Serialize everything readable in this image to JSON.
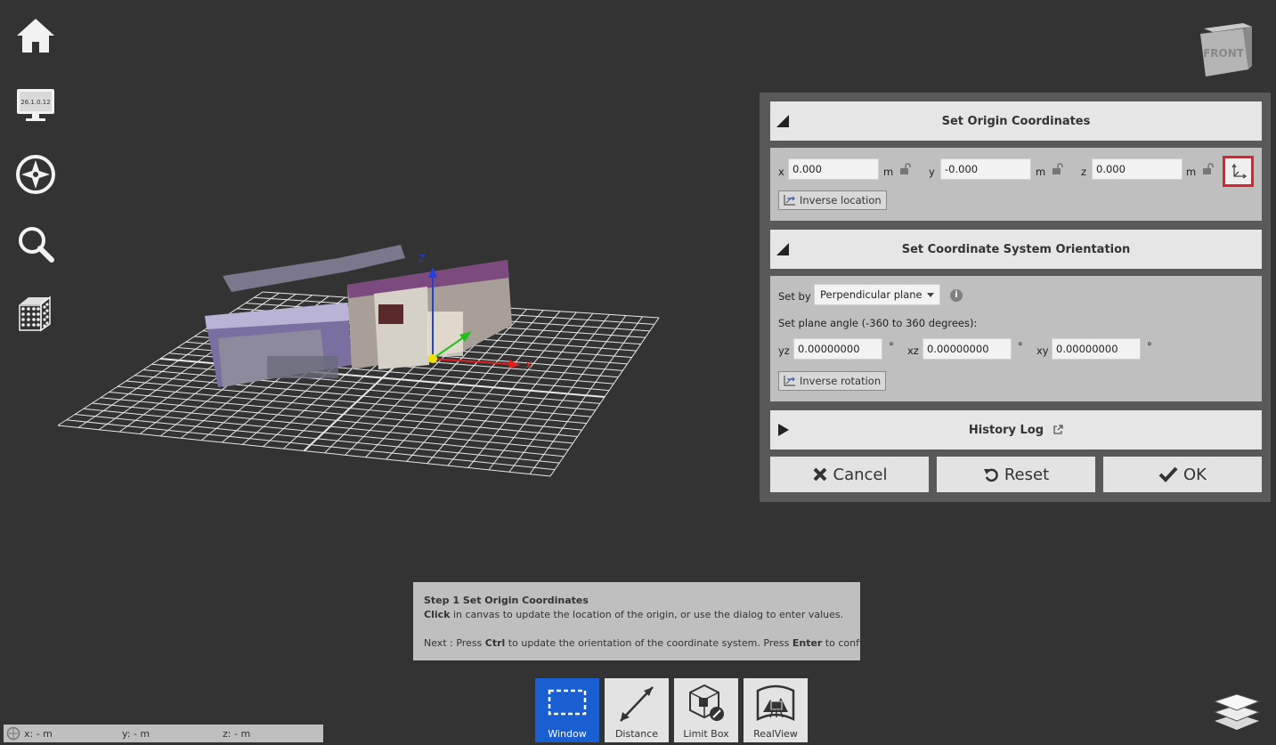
{
  "left_nav": {
    "items": [
      {
        "name": "home-icon"
      },
      {
        "name": "monitor-icon",
        "text": "26.1.0.12"
      },
      {
        "name": "compass-icon"
      },
      {
        "name": "search-icon"
      },
      {
        "name": "grid-cube-icon"
      }
    ]
  },
  "view_cube": {
    "face_label": "FRONT"
  },
  "canvas": {
    "x_axis_label": "X",
    "z_axis_label": "Z"
  },
  "dialog": {
    "origin": {
      "title": "Set Origin Coordinates",
      "x_label": "x",
      "x_value": "0.000",
      "y_label": "y",
      "y_value": "-0.000",
      "z_label": "z",
      "z_value": "0.000",
      "unit": "m",
      "inverse_location_label": "Inverse location"
    },
    "orientation": {
      "title": "Set Coordinate System Orientation",
      "set_by_label": "Set by",
      "set_by_value": "Perpendicular plane",
      "plane_angle_label": "Set plane angle (-360 to 360 degrees):",
      "yz_label": "yz",
      "yz_value": "0.00000000",
      "xz_label": "xz",
      "xz_value": "0.00000000",
      "xy_label": "xy",
      "xy_value": "0.00000000",
      "degree": "°",
      "inverse_rotation_label": "Inverse rotation"
    },
    "history": {
      "title": "History Log"
    },
    "buttons": {
      "cancel": "Cancel",
      "reset": "Reset",
      "ok": "OK"
    }
  },
  "hint": {
    "step_title": "Step 1 Set Origin Coordinates",
    "click_bold": "Click",
    "click_rest": " in canvas to update the location of the origin, or use the dialog to enter values.",
    "next_prefix": "Next : Press ",
    "ctrl": "Ctrl",
    "next_middle": " to update the orientation of the coordinate system. Press ",
    "enter": "Enter",
    "next_suffix": " to confirm."
  },
  "toolbar": {
    "window": "Window",
    "distance": "Distance",
    "limit_box": "Limit Box",
    "realview": "RealView"
  },
  "coord_bar": {
    "x": "x:  - m",
    "y": "y:  - m",
    "z": "z:  - m"
  },
  "colors": {
    "background": "#333333",
    "active_tool": "#1a5fd1",
    "highlight": "#e0202a",
    "axis_x": "#e02020",
    "axis_y": "#20c020",
    "axis_z": "#2040e0"
  }
}
